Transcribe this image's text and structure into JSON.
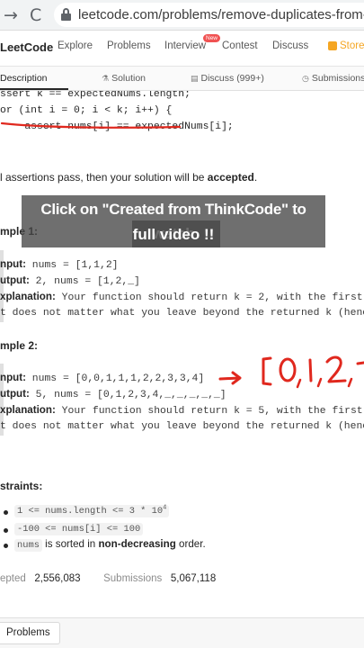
{
  "browser": {
    "url": "leetcode.com/problems/remove-duplicates-from-s"
  },
  "nav": {
    "logo": "LeetCode",
    "items": [
      "Explore",
      "Problems",
      "Interview",
      "Contest",
      "Discuss",
      "Store"
    ],
    "badge": "New"
  },
  "tabs": [
    "Description",
    "Solution",
    "Discuss (999+)",
    "Submissions"
  ],
  "code": {
    "line1": "ssert k == expectedNums.length;",
    "line2": "or (int i = 0; i < k; i++) {",
    "line3": "    assert nums[i] == expectedNums[i];"
  },
  "accept_sentence": {
    "before": "l assertions pass, then your solution will be ",
    "emph": "accepted",
    "after": "."
  },
  "overlay": {
    "line1": "Click on \"Created from ThinkCode\" to watch",
    "line2": "full video !!"
  },
  "example1": {
    "heading": "mple 1:",
    "input_label": "nput:",
    "input_value": " nums = [1,1,2]",
    "output_label": "utput:",
    "output_value": " 2, nums = [1,2,_]",
    "expl_label": "xplanation:",
    "expl_value": " Your function should return k = 2, with the first",
    "expl_cont": "t does not matter what you leave beyond the returned k (hence"
  },
  "example2": {
    "heading": "mple 2:",
    "input_label": "nput:",
    "input_value": " nums = [0,0,1,1,1,2,2,3,3,4]",
    "output_label": "utput:",
    "output_value": " 5, nums = [0,1,2,3,4,_,_,_,_,_]",
    "expl_label": "xplanation:",
    "expl_value": " Your function should return k = 5, with the first",
    "expl_cont": "t does not matter what you leave beyond the returned k (hence"
  },
  "constraints": {
    "heading": "straints:",
    "c1_code": "1 <= nums.length <= 3 * 10",
    "c1_sup": "4",
    "c2_code": "-100 <= nums[i] <= 100",
    "c3_code": "nums",
    "c3_text_before": " is sorted in ",
    "c3_emph": "non-decreasing",
    "c3_text_after": " order."
  },
  "stats": {
    "accepted_label": "epted",
    "accepted_value": "2,556,083",
    "submissions_label": "Submissions",
    "submissions_value": "5,067,118"
  },
  "bottom": {
    "problems_label": "Problems"
  },
  "colors": {
    "ink_red": "#e0281e",
    "store": "#f5a623",
    "badge": "#f05252"
  }
}
